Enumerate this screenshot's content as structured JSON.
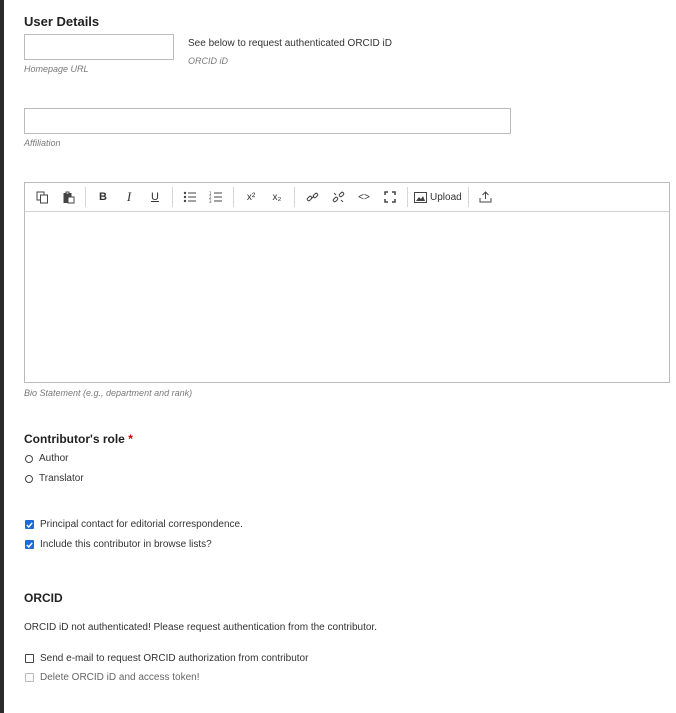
{
  "user_details": {
    "title": "User Details",
    "homepage_label": "Homepage URL",
    "homepage_value": "",
    "orcid_note": "See below to request authenticated ORCID iD",
    "orcid_label": "ORCID iD",
    "affiliation_label": "Affiliation",
    "affiliation_value": ""
  },
  "editor": {
    "toolbar": {
      "copy": "copy-icon",
      "paste": "paste-icon",
      "bold": "B",
      "italic": "I",
      "underline": "U",
      "bullet_list": "bulleted-list-icon",
      "numbered_list": "numbered-list-icon",
      "superscript": "x²",
      "subscript": "x₂",
      "link": "link-icon",
      "unlink": "unlink-icon",
      "code": "<>",
      "fullscreen": "fullscreen-icon",
      "upload_label": "Upload",
      "upload_file": "upload-icon"
    },
    "bio_label": "Bio Statement (e.g., department and rank)"
  },
  "role": {
    "title": "Contributor's role",
    "required_mark": "*",
    "options": [
      "Author",
      "Translator"
    ]
  },
  "contact": {
    "principal_label": "Principal contact for editorial correspondence.",
    "principal_checked": true,
    "browse_label": "Include this contributor in browse lists?",
    "browse_checked": true
  },
  "orcid": {
    "title": "ORCID",
    "status_text": "ORCID iD not authenticated! Please request authentication from the contributor.",
    "send_email_label": "Send e-mail to request ORCID authorization from contributor",
    "delete_label": "Delete ORCID iD and access token!"
  },
  "colors": {
    "accent": "#1e6bd6",
    "required": "#d00000"
  }
}
